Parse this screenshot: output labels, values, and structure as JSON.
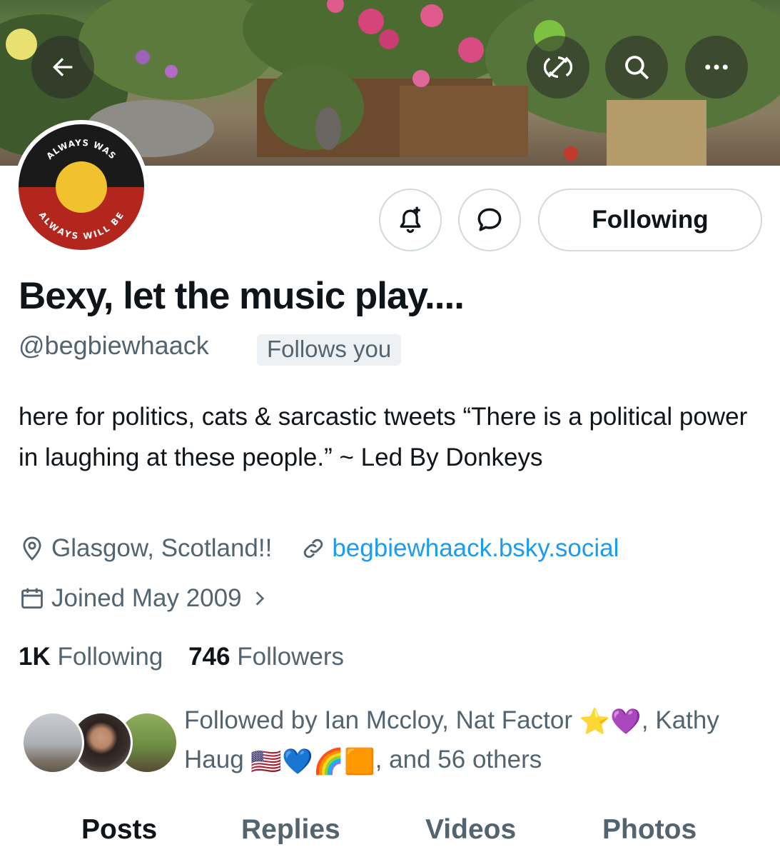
{
  "header": {
    "back_icon": "arrow-left-icon",
    "sync_icon": "sync-slash-icon",
    "search_icon": "search-icon",
    "more_icon": "more-dots-icon"
  },
  "avatar": {
    "top_text": "ALWAYS WAS",
    "bottom_text": "ALWAYS WILL BE",
    "colors": {
      "top": "#1a1a1a",
      "bottom": "#b3261e",
      "sun": "#f2c12e"
    }
  },
  "actions": {
    "notify_icon": "bell-plus-icon",
    "message_icon": "message-bubble-icon",
    "following_label": "Following"
  },
  "profile": {
    "display_name": "Bexy, let the music play....",
    "handle": "@begbiewhaack",
    "follows_you": "Follows you",
    "bio": "here for politics, cats & sarcastic tweets “There is a political power in laughing at these people.” ~ Led By Donkeys",
    "location": "Glasgow, Scotland!!",
    "website": "begbiewhaack.bsky.social",
    "joined": "Joined May 2009",
    "following_count": "1K",
    "following_label": "Following",
    "followers_count": "746",
    "followers_label": "Followers"
  },
  "followed_by": {
    "prefix": "Followed by Ian Mccloy, Nat Factor",
    "emoji_group1": "⭐💜",
    "middle": ", Kathy Haug",
    "emoji_group2": "🇺🇸💙🌈🟧",
    "suffix": ", and 56 others"
  },
  "tabs": [
    "Posts",
    "Replies",
    "Videos",
    "Photos"
  ],
  "colors": {
    "link": "#1d9bf0",
    "secondary_text": "#536471",
    "primary_text": "#0f1419"
  }
}
